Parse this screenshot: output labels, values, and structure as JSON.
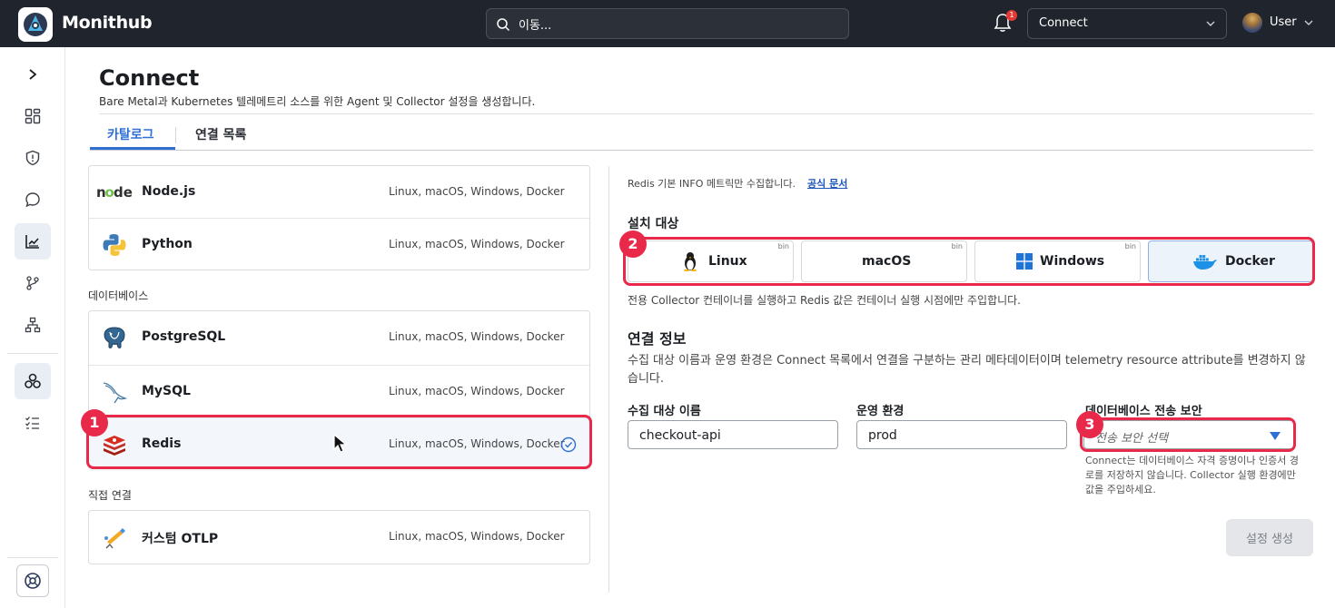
{
  "header": {
    "brand": "Monithub",
    "search_placeholder": "이동...",
    "notification_count": "1",
    "context_select": "Connect",
    "user_name": "User"
  },
  "page": {
    "title": "Connect",
    "subtitle": "Bare Metal과 Kubernetes 텔레메트리 소스를 위한 Agent 및 Collector 설정을 생성합니다.",
    "tabs": [
      {
        "label": "카탈로그",
        "active": true
      },
      {
        "label": "연결 목록",
        "active": false
      }
    ]
  },
  "catalog": {
    "runtime_items": [
      {
        "name": "Node.js",
        "platforms": "Linux, macOS, Windows, Docker",
        "icon": "nodejs-icon"
      },
      {
        "name": "Python",
        "platforms": "Linux, macOS, Windows, Docker",
        "icon": "python-icon"
      }
    ],
    "database_label": "데이터베이스",
    "database_items": [
      {
        "name": "PostgreSQL",
        "platforms": "Linux, macOS, Windows, Docker",
        "icon": "postgresql-icon"
      },
      {
        "name": "MySQL",
        "platforms": "Linux, macOS, Windows, Docker",
        "icon": "mysql-icon"
      },
      {
        "name": "Redis",
        "platforms": "Linux, macOS, Windows, Docker",
        "icon": "redis-icon",
        "selected": true
      }
    ],
    "direct_label": "직접 연결",
    "direct_items": [
      {
        "name": "커스텀 OTLP",
        "platforms": "Linux, macOS, Windows, Docker",
        "icon": "otlp-icon"
      }
    ]
  },
  "detail": {
    "info_text": "Redis 기본 INFO 메트릭만 수집합니다.",
    "doc_link": "공식 문서",
    "install_target_label": "설치 대상",
    "targets": [
      {
        "label": "Linux",
        "tag": "bin",
        "icon": "linux-icon",
        "selected": false
      },
      {
        "label": "macOS",
        "tag": "bin",
        "icon": "",
        "selected": false
      },
      {
        "label": "Windows",
        "tag": "bin",
        "icon": "windows-icon",
        "selected": false
      },
      {
        "label": "Docker",
        "tag": "",
        "icon": "docker-icon",
        "selected": true
      }
    ],
    "target_note": "전용 Collector 컨테이너를 실행하고 Redis 값은 컨테이너 실행 시점에만 주입합니다.",
    "conn_info_label": "연결 정보",
    "conn_info_desc": "수집 대상 이름과 운영 환경은 Connect 목록에서 연결을 구분하는 관리 메타데이터이며 telemetry resource attribute를 변경하지 않습니다.",
    "fields": {
      "target_name_label": "수집 대상 이름",
      "target_name_value": "checkout-api",
      "env_label": "운영 환경",
      "env_value": "prod",
      "security_label": "데이터베이스 전송 보안",
      "security_placeholder": "전송 보안 선택",
      "security_help": "Connect는 데이터베이스 자격 증명이나 인증서 경로를 저장하지 않습니다. Collector 실행 환경에만 값을 주입하세요."
    },
    "generate_button": "설정 생성"
  },
  "annotations": [
    "1",
    "2",
    "3"
  ],
  "colors": {
    "accent": "#2f6fd3",
    "highlight": "#e8294a",
    "topbar": "#20242c"
  }
}
